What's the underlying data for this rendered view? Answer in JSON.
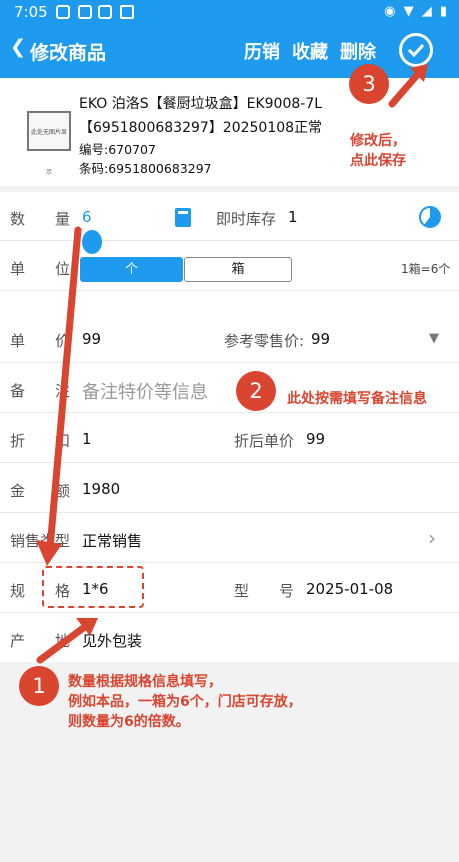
{
  "status_bar": {
    "time": "7:05"
  },
  "nav": {
    "back_icon": "chevron-left-icon",
    "title": "修改商品",
    "actions": [
      "历销",
      "收藏",
      "删除"
    ],
    "save_icon": "check-circle-icon"
  },
  "product": {
    "thumbnail_text": "此处无图片显示",
    "title_line1": "EKO 泊洛S【餐厨垃圾盒】EK9008-7L",
    "title_line2": "【6951800683297】20250108正常",
    "code": "编号:670707",
    "barcode": "条码:6951800683297"
  },
  "form": {
    "quantity": {
      "label": "数　　量",
      "value": "6",
      "stock_label": "即时库存",
      "stock_value": "1"
    },
    "unit": {
      "label": "单　　位",
      "options": [
        "个",
        "箱"
      ],
      "selected": "个",
      "ratio": "1箱=6个"
    },
    "price": {
      "label": "单　　价",
      "value": "99",
      "retail_label": "参考零售价:",
      "retail_value": "99"
    },
    "remark": {
      "label": "备　　注",
      "placeholder": "备注特价等信息"
    },
    "discount": {
      "label": "折　　扣",
      "value": "1",
      "discount_price_label": "折后单价",
      "discount_price_value": "99"
    },
    "amount": {
      "label": "金　　额",
      "value": "1980"
    },
    "sale_type": {
      "label": "销售类型",
      "value": "正常销售"
    },
    "spec": {
      "label": "规　　格",
      "value": "1*6",
      "model_label": "型　　号",
      "model_value": "2025-01-08"
    },
    "origin": {
      "label": "产　　地",
      "value": "见外包装"
    }
  },
  "annotations": {
    "n1": "1",
    "n2": "2",
    "n3": "3",
    "note1_lines": [
      "数量根据规格信息填写，",
      "例如本品，一箱为6个，门店可存放，",
      "则数量为6的倍数。"
    ],
    "note2": "此处按需填写备注信息",
    "note3_lines": [
      "修改后，",
      "点此保存"
    ]
  },
  "colors": {
    "primary": "#1e9bef",
    "annotation": "#d9452f"
  }
}
